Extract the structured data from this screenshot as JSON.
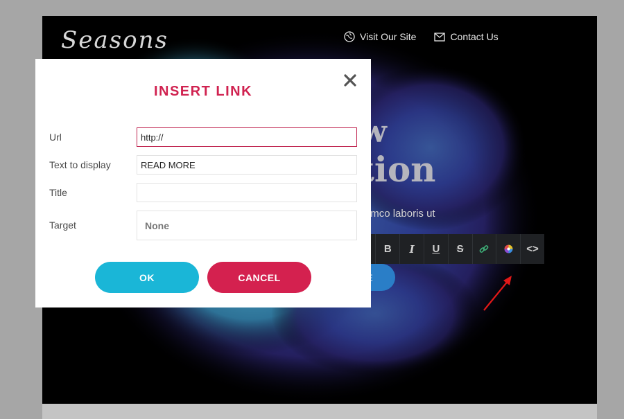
{
  "site": {
    "logo_text": "Seasons",
    "nav": [
      {
        "label": "Visit Our Site",
        "icon": "globe-icon"
      },
      {
        "label": "Contact Us",
        "icon": "envelope-icon"
      }
    ],
    "headline_line1": "new",
    "headline_line2": "ration",
    "subtext": "tation ullamco laboris ut",
    "readmore_label": "AD MORE",
    "toolbar": {
      "selected_fragment": "s",
      "buttons": [
        {
          "name": "bold-button",
          "glyph": "B",
          "icon": "bold-icon"
        },
        {
          "name": "italic-button",
          "glyph": "I",
          "icon": "italic-icon"
        },
        {
          "name": "underline-button",
          "glyph": "U",
          "icon": "underline-icon"
        },
        {
          "name": "strikethrough-button",
          "glyph": "S",
          "icon": "strikethrough-icon"
        },
        {
          "name": "link-button",
          "glyph": "",
          "icon": "link-icon"
        },
        {
          "name": "color-button",
          "glyph": "",
          "icon": "color-wheel-icon"
        },
        {
          "name": "code-button",
          "glyph": "<>",
          "icon": "code-icon"
        }
      ]
    },
    "colors": {
      "accent_red": "#d4214f",
      "accent_cyan": "#1ab6d7",
      "blue_button": "#2a7ec7"
    }
  },
  "modal": {
    "title": "INSERT LINK",
    "close_icon": "close-icon",
    "fields": {
      "url": {
        "label": "Url",
        "value": "http://"
      },
      "text": {
        "label": "Text to display",
        "value": "READ MORE"
      },
      "title": {
        "label": "Title",
        "value": ""
      },
      "target": {
        "label": "Target",
        "value": "None"
      }
    },
    "ok_label": "OK",
    "cancel_label": "CANCEL"
  }
}
